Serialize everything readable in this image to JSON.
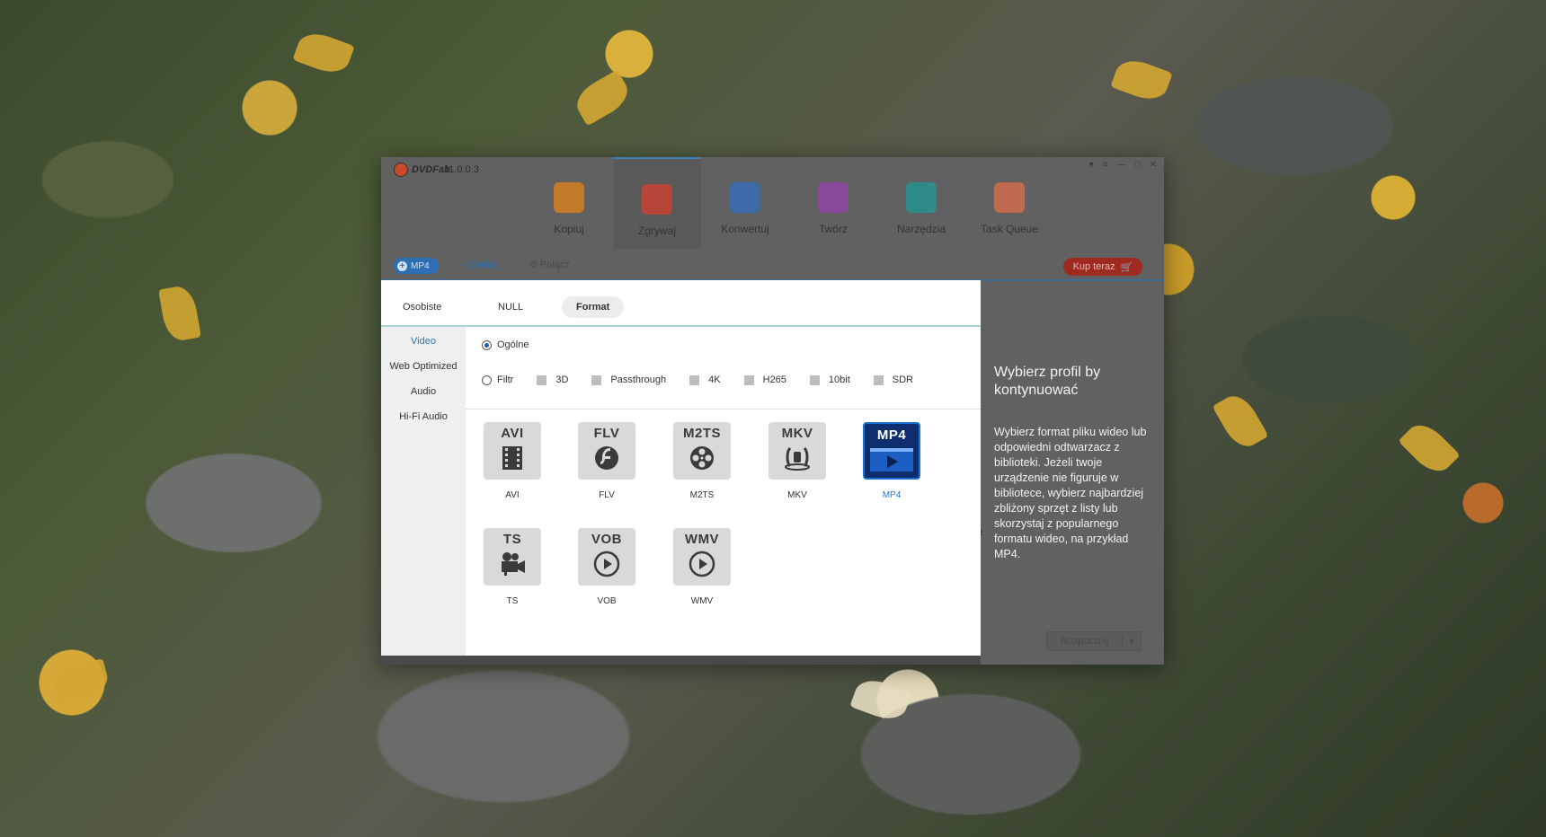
{
  "app": {
    "logo_text": "DVDFab",
    "version": "11.0.0.3",
    "window_controls": [
      "▾",
      "≡",
      "—",
      "□",
      "✕"
    ]
  },
  "modules": [
    {
      "label": "Kopiuj",
      "icon": "copy-disc-icon",
      "color": "#c07a2a",
      "active": false
    },
    {
      "label": "Zgrywaj",
      "icon": "ripper-disc-icon",
      "color": "#b8453a",
      "active": true
    },
    {
      "label": "Konwertuj",
      "icon": "converter-film-icon",
      "color": "#3d6aa8",
      "active": false
    },
    {
      "label": "Twórz",
      "icon": "creator-film-icon",
      "color": "#8a4a9a",
      "active": false
    },
    {
      "label": "Narzędzia",
      "icon": "toolbox-icon",
      "color": "#2f8a8a",
      "active": false
    },
    {
      "label": "Task Queue",
      "icon": "task-queue-icon",
      "color": "#c06a52",
      "active": false
    }
  ],
  "toolbar": {
    "profile_pill": "MP4",
    "add": "Dodaj",
    "merge": "Połącz",
    "buy": "Kup teraz"
  },
  "right_panel": {
    "title": "Wybierz profil by kontynuować",
    "body": "Wybierz format pliku wideo lub odpowiedni odtwarzacz z biblioteki. Jeżeli twoje urządzenie nie figuruje w bibliotece, wybierz najbardziej zbliżony sprzęt z listy lub skorzystaj z popularnego formatu wideo, na przykład MP4.",
    "stray_char": "e",
    "start_button": "Rozpocznij"
  },
  "dialog": {
    "tabs": [
      {
        "label": "Osobiste",
        "selected": false
      },
      {
        "label": "NULL",
        "selected": false
      },
      {
        "label": "Format",
        "selected": true
      }
    ],
    "sidebar": [
      {
        "label": "Video",
        "active": true
      },
      {
        "label": "Web Optimized",
        "active": false
      },
      {
        "label": "Audio",
        "active": false
      },
      {
        "label": "Hi-Fi Audio",
        "active": false
      }
    ],
    "radio_general": "Ogólne",
    "radio_filter": "Filtr",
    "checkboxes": [
      "3D",
      "Passthrough",
      "4K",
      "H265",
      "10bit",
      "SDR"
    ],
    "formats": [
      {
        "tile": "AVI",
        "label": "AVI",
        "icon": "film-strip-icon",
        "selected": false
      },
      {
        "tile": "FLV",
        "label": "FLV",
        "icon": "flash-icon",
        "selected": false
      },
      {
        "tile": "M2TS",
        "label": "M2TS",
        "icon": "film-reel-icon",
        "selected": false
      },
      {
        "tile": "MKV",
        "label": "MKV",
        "icon": "mkv-icon",
        "selected": false
      },
      {
        "tile": "MP4",
        "label": "MP4",
        "icon": "play-film-icon",
        "selected": true
      },
      {
        "tile": "TS",
        "label": "TS",
        "icon": "camera-icon",
        "selected": false
      },
      {
        "tile": "VOB",
        "label": "VOB",
        "icon": "play-circle-icon",
        "selected": false
      },
      {
        "tile": "WMV",
        "label": "WMV",
        "icon": "play-circle-icon",
        "selected": false
      }
    ]
  }
}
